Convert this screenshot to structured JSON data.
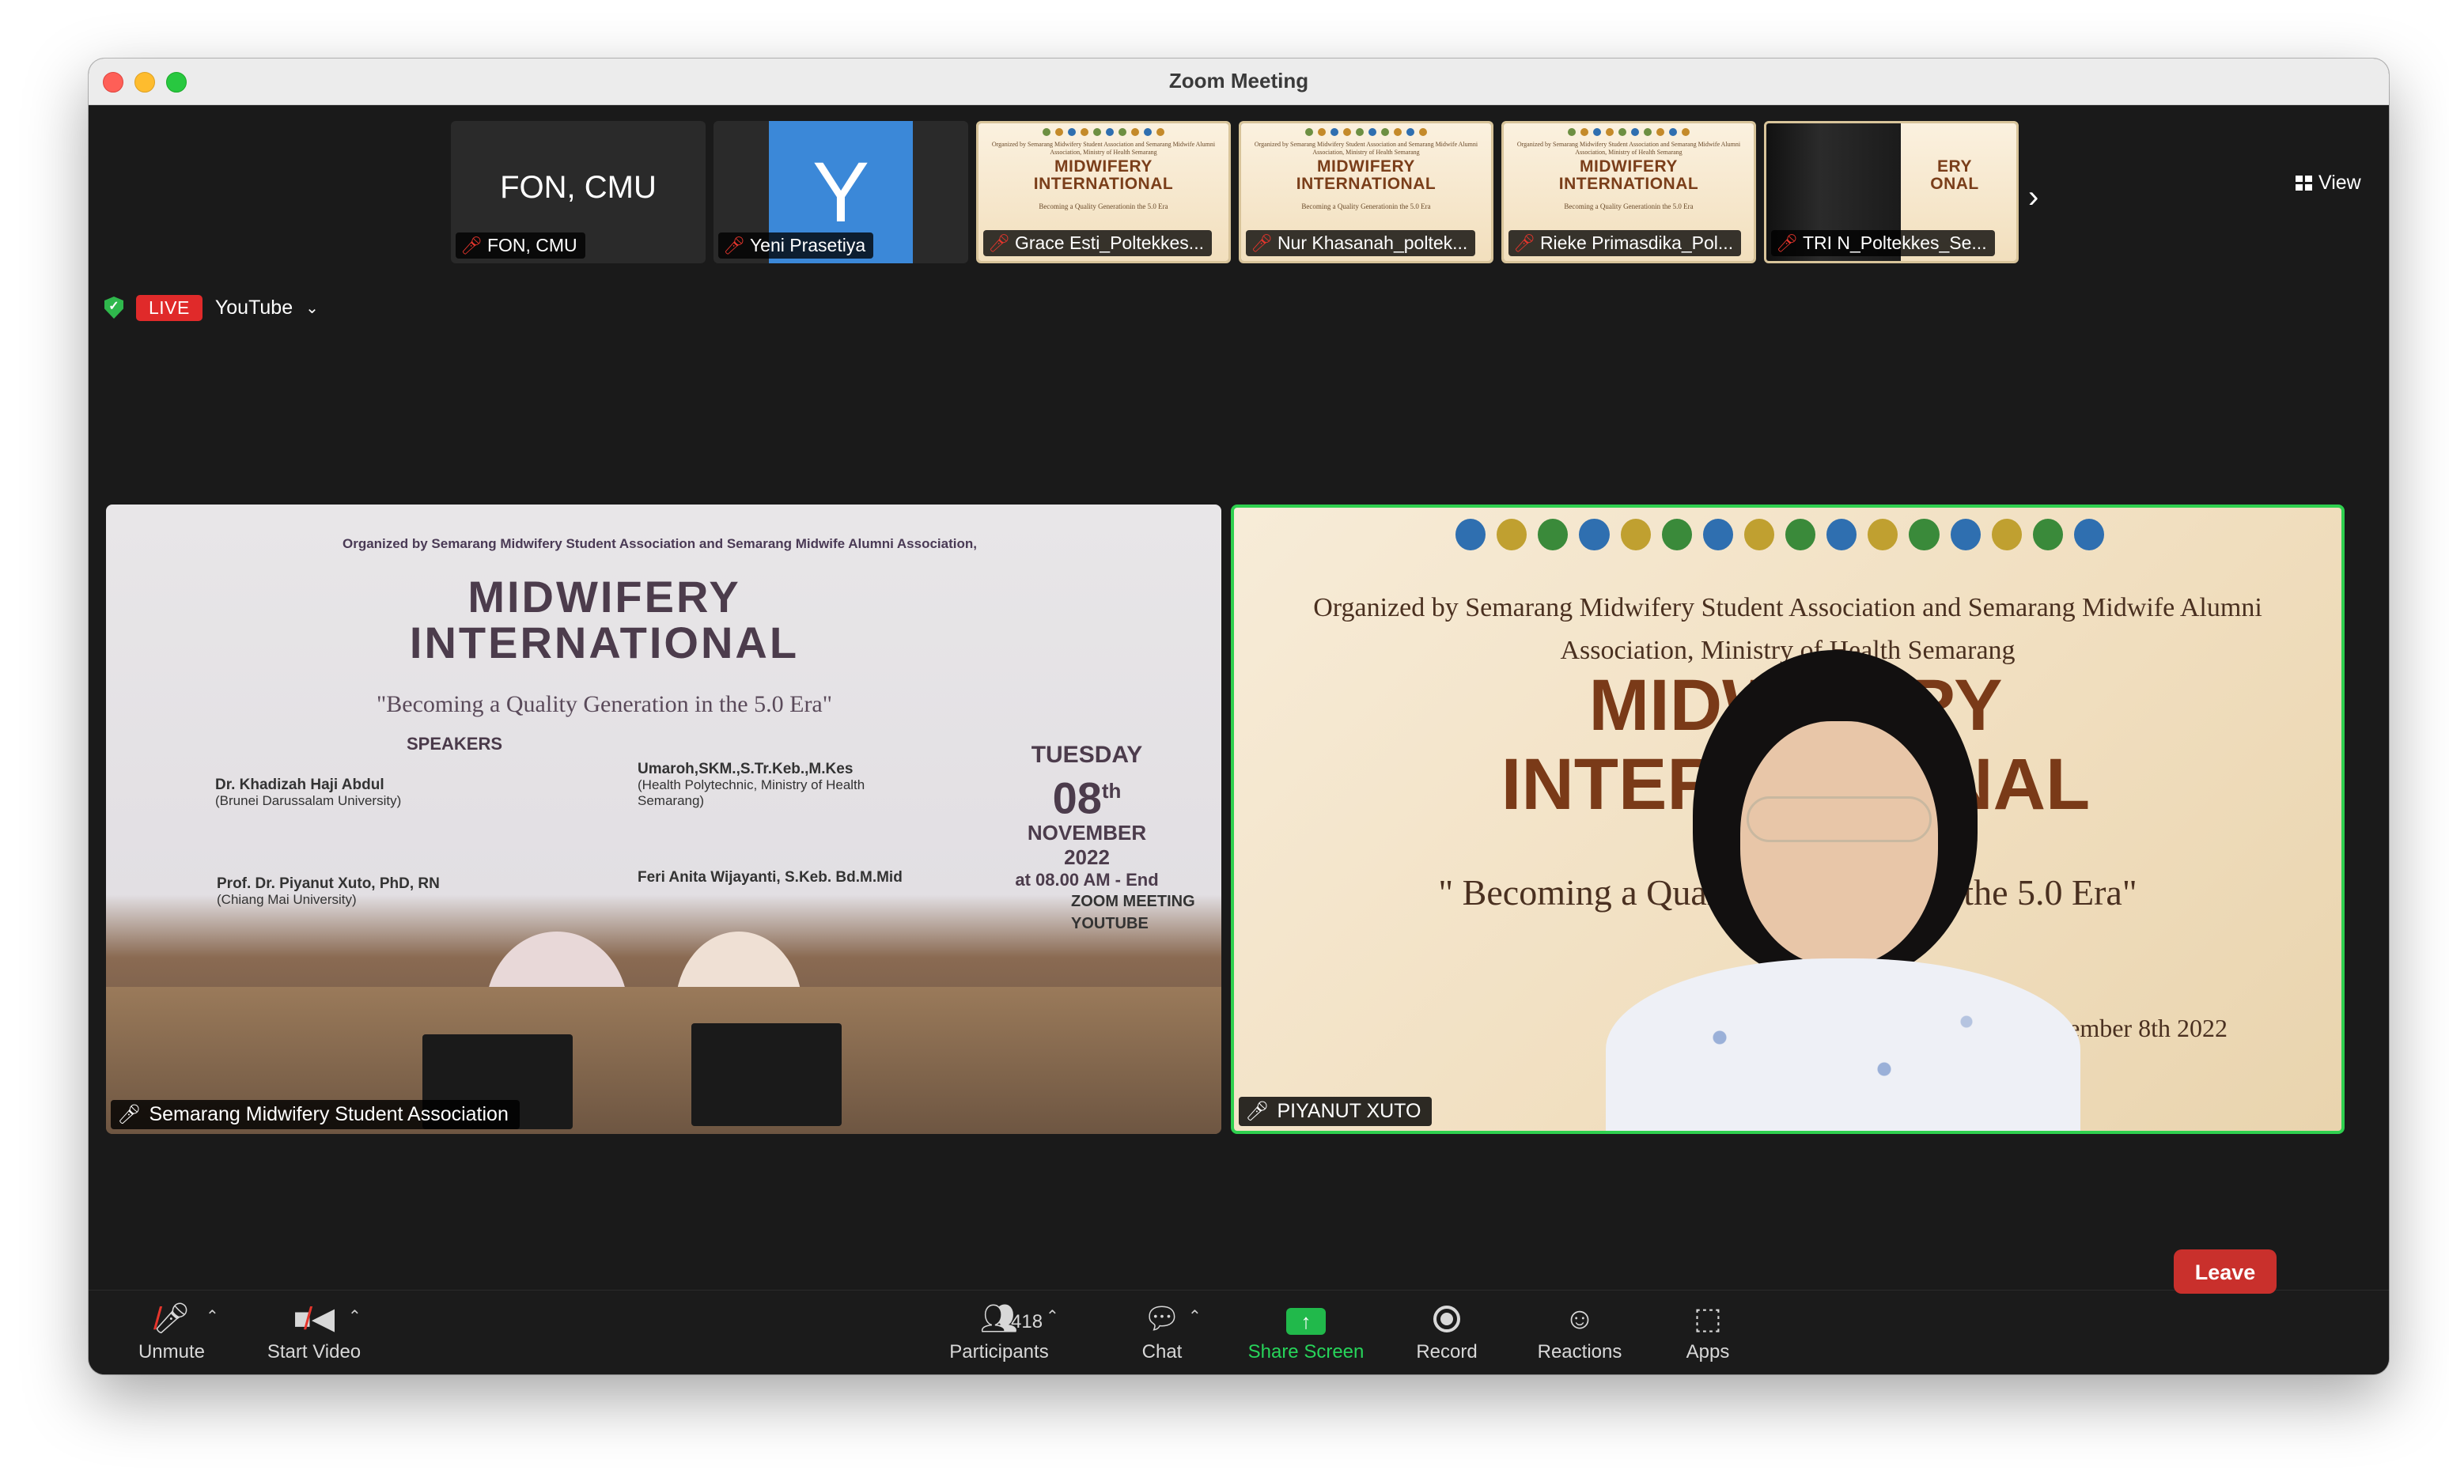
{
  "window": {
    "title": "Zoom Meeting"
  },
  "participant_strip": {
    "tiles": [
      {
        "display": "FON, CMU",
        "name": "FON, CMU"
      },
      {
        "avatar_letter": "Y",
        "name": "Yeni Prasetiya"
      },
      {
        "name": "Grace Esti_Poltekkes..."
      },
      {
        "name": "Nur Khasanah_poltek..."
      },
      {
        "name": "Rieke Primasdika_Pol..."
      },
      {
        "name": "TRI N_Poltekkes_Se..."
      }
    ],
    "mini_poster": {
      "org": "Organized by Semarang Midwifery Student Association and Semarang Midwife Alumni Association, Ministry of Health Semarang",
      "title_line1": "MIDWIFERY",
      "title_line2": "INTERNATIONAL",
      "subtitle": "Becoming a Quality Generationin the 5.0 Era"
    },
    "next_icon": "chevron-right-icon"
  },
  "view_button": {
    "label": "View"
  },
  "stream": {
    "badge": "LIVE",
    "platform": "YouTube"
  },
  "videos": {
    "left": {
      "name": "Semarang Midwifery Student Association",
      "banner": {
        "org": "Organized by Semarang Midwifery Student Association and Semarang Midwife Alumni Association,",
        "title_line1": "MIDWIFERY",
        "title_line2": "INTERNATIONAL",
        "subtitle": "\"Becoming a Quality Generation in the 5.0 Era\"",
        "speakers_label": "SPEAKERS",
        "speaker1_name": "Dr. Khadizah Haji Abdul",
        "speaker1_aff": "(Brunei Darussalam University)",
        "speaker2_name": "Prof. Dr. Piyanut Xuto, PhD, RN",
        "speaker2_aff": "(Chiang Mai University)",
        "speaker3_name": "Umaroh,SKM.,S.Tr.Keb.,M.Kes",
        "speaker3_aff": "(Health Polytechnic, Ministry of Health Semarang)",
        "speaker4_name": "Feri Anita Wijayanti, S.Keb. Bd.M.Mid",
        "date_day": "TUESDAY",
        "date_num": "08",
        "date_sup": "th",
        "date_month": "NOVEMBER",
        "date_year": "2022",
        "date_time": "at 08.00 AM - End",
        "zoom": "ZOOM MEETING",
        "youtube": "YOUTUBE"
      }
    },
    "right": {
      "name": "PIYANUT XUTO",
      "banner": {
        "org_line1": "Organized by Semarang Midwifery Student Association and Semarang Midwife Alumni",
        "org_line2": "Association, Ministry of Health Semarang",
        "title_line1": "MIDWIFERY",
        "title_line2": "INTERNATIONAL",
        "subtitle": "\" Becoming a Quality Generationin the 5.0 Era\"",
        "date": "November 8th 2022"
      }
    }
  },
  "toolbar": {
    "unmute": "Unmute",
    "start_video": "Start Video",
    "participants": "Participants",
    "participants_count": "418",
    "chat": "Chat",
    "share_screen": "Share Screen",
    "record": "Record",
    "reactions": "Reactions",
    "apps": "Apps",
    "leave": "Leave"
  },
  "colors": {
    "accent_green": "#2fd04f",
    "live_red": "#e02a2a",
    "leave_red": "#c9302c",
    "share_green": "#21b94b",
    "avatar_blue": "#3b88d8"
  }
}
